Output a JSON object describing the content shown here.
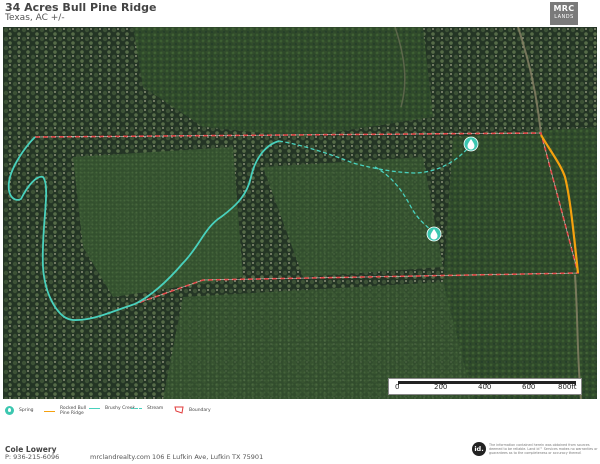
{
  "header": {
    "title": "34 Acres Bull Pine Ridge",
    "subtitle": "Texas,  AC +/-",
    "logo_line1": "MRC",
    "logo_line2": "LANDS"
  },
  "map": {
    "type": "aerial-satellite",
    "base_colors": {
      "forest_dark": "#1f2e1f",
      "pine_stand": "#34502c",
      "canopy_light": "#5a7046"
    },
    "features": {
      "boundary": {
        "color": "#e03a3a",
        "style": "dashed"
      },
      "road": {
        "color": "#f5a10f",
        "style": "solid"
      },
      "brushy_creek": {
        "color": "#49d1bd",
        "style": "solid"
      },
      "stream": {
        "color": "#49d1bd",
        "style": "dashed"
      },
      "springs": {
        "color": "#3cc7b0",
        "icon": "water-drop-icon",
        "count": 2
      }
    }
  },
  "scale_bar": {
    "labels": [
      "0",
      "200",
      "400",
      "600",
      "800ft"
    ]
  },
  "legend": {
    "items": [
      {
        "key": "spring",
        "label": "Spring",
        "icon": "spring-icon"
      },
      {
        "key": "road",
        "label_line1": "Rocked Bull",
        "label_line2": "Pine Ridge",
        "color": "#f5a10f"
      },
      {
        "key": "creek",
        "label": "Brushy Creek",
        "color": "#49d1bd"
      },
      {
        "key": "stream",
        "label": "Stream",
        "color": "#49d1bd"
      },
      {
        "key": "boundary",
        "label": "Boundary",
        "color": "#e03a3a",
        "icon": "boundary-polygon-icon"
      }
    ]
  },
  "footer": {
    "agent_name": "Cole Lowery",
    "agent_phone": "P: 936-215-6096",
    "website": "mrclandrealty.com",
    "address": "106 E Lufkin Ave, Lufkin TX 75901",
    "disclaimer": "The information contained herein was obtained from sources deemed to be reliable. Land id™ Services makes no warranties or guarantees as to the completeness or accuracy thereof."
  }
}
